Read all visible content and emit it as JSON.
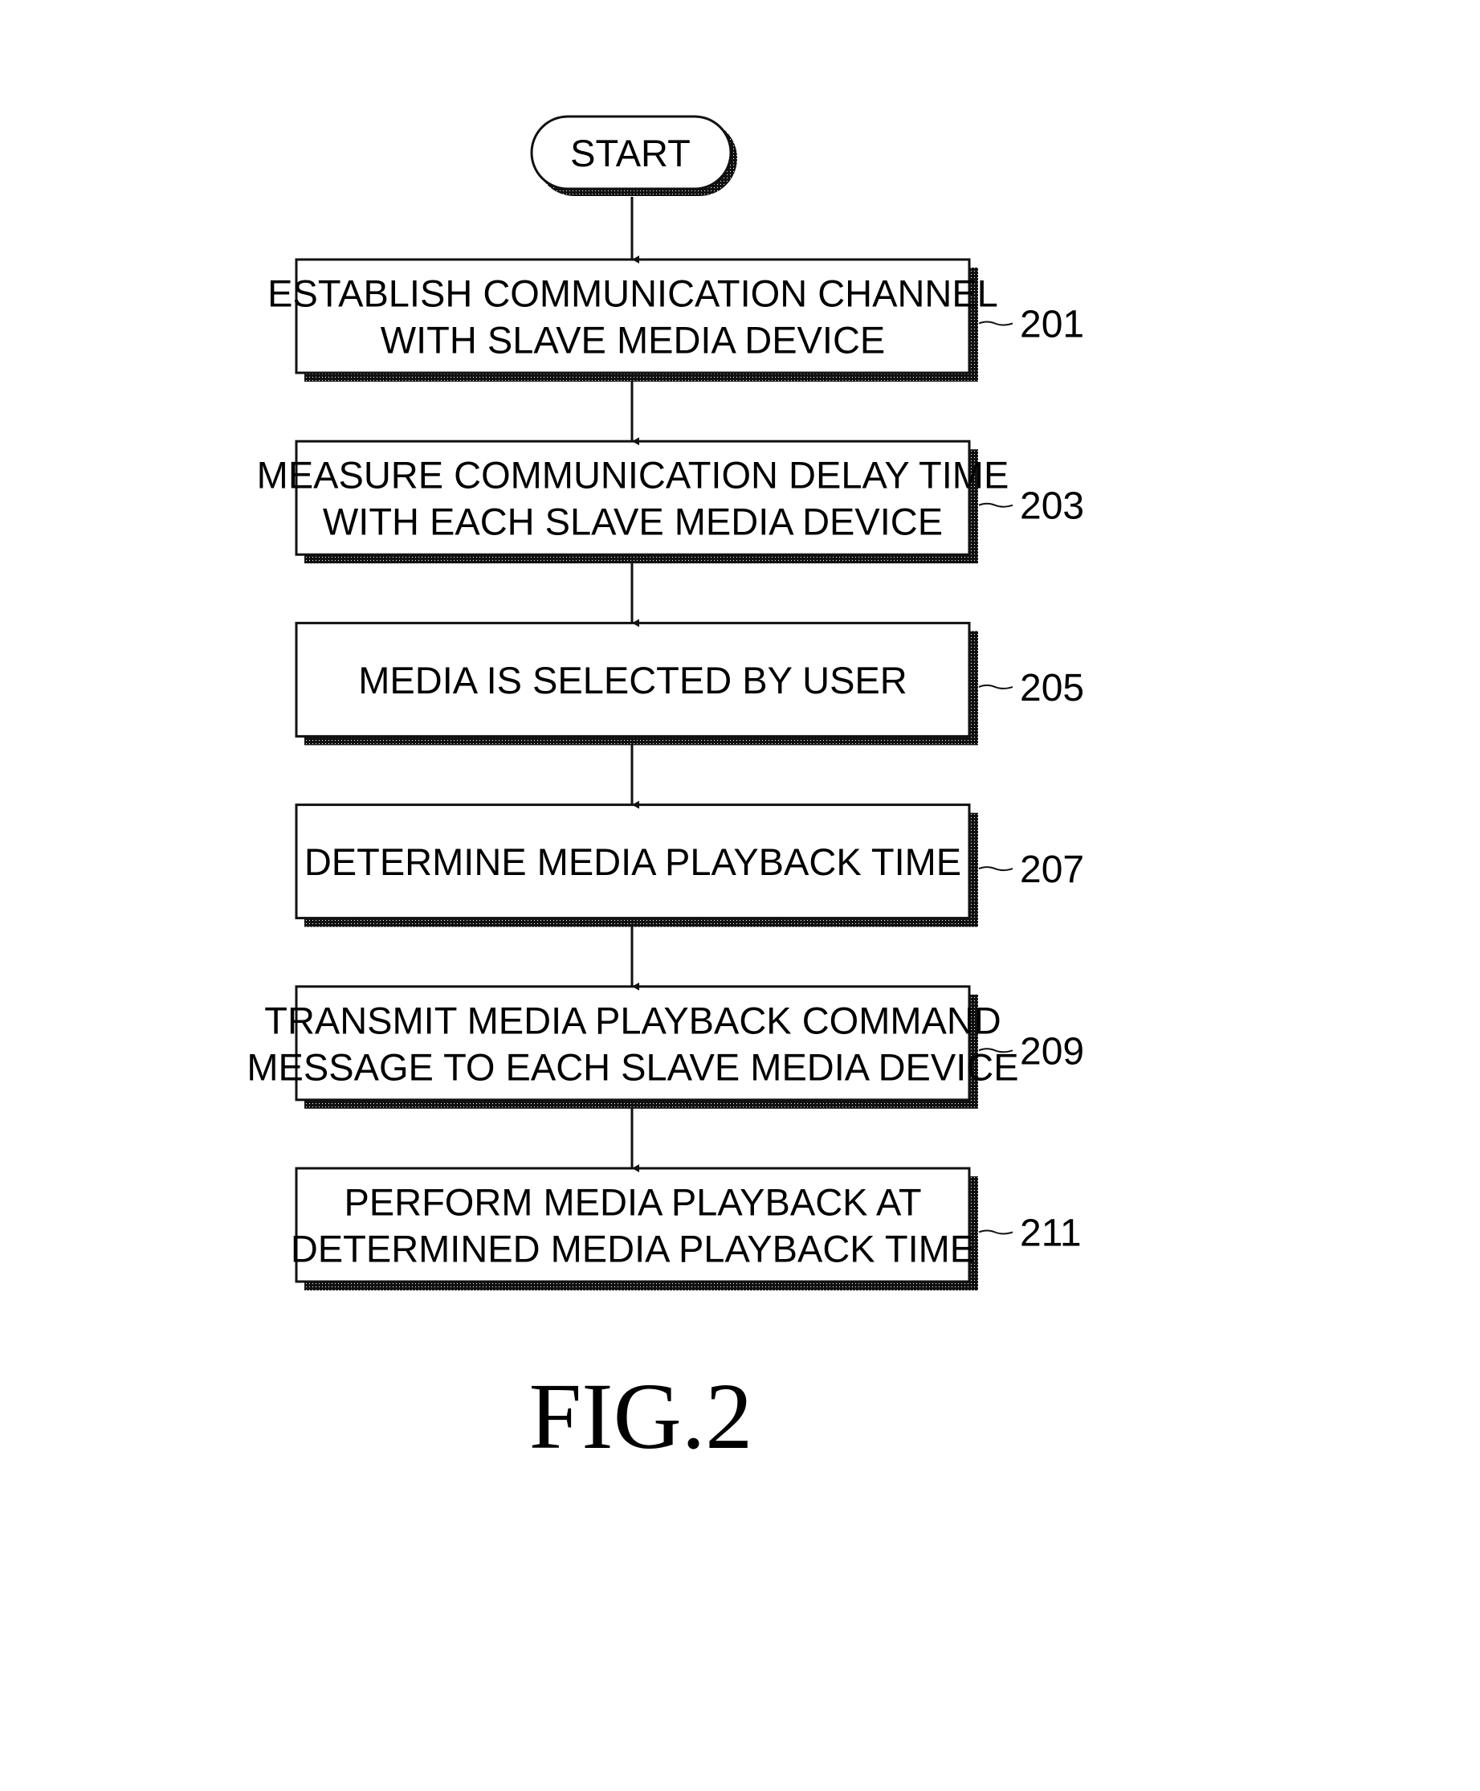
{
  "figure": {
    "caption": "FIG.2",
    "start": {
      "label": "START"
    },
    "steps": [
      {
        "id": "201",
        "lines": [
          "ESTABLISH COMMUNICATION CHANNEL",
          "WITH SLAVE MEDIA DEVICE"
        ]
      },
      {
        "id": "203",
        "lines": [
          "MEASURE COMMUNICATION DELAY TIME",
          "WITH EACH SLAVE MEDIA DEVICE"
        ]
      },
      {
        "id": "205",
        "lines": [
          "MEDIA IS SELECTED BY USER"
        ]
      },
      {
        "id": "207",
        "lines": [
          "DETERMINE MEDIA PLAYBACK TIME"
        ]
      },
      {
        "id": "209",
        "lines": [
          "TRANSMIT MEDIA PLAYBACK COMMAND",
          "MESSAGE TO EACH SLAVE MEDIA DEVICE"
        ]
      },
      {
        "id": "211",
        "lines": [
          "PERFORM MEDIA PLAYBACK AT",
          "DETERMINED MEDIA PLAYBACK TIME"
        ]
      }
    ]
  }
}
